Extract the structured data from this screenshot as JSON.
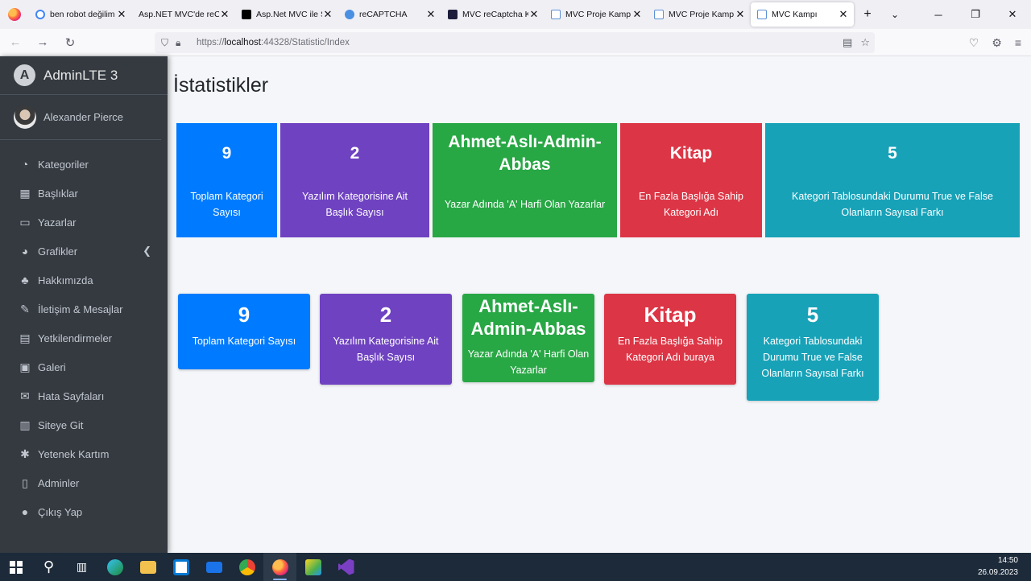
{
  "browser": {
    "tabs": [
      {
        "label": "ben robot değilim",
        "color": "#4285f4"
      },
      {
        "label": "Asp.NET MVC'de reCAPTCHA",
        "color": ""
      },
      {
        "label": "Asp.Net MVC ile S",
        "color": "#000000"
      },
      {
        "label": "reCAPTCHA",
        "color": "#4a90e2"
      },
      {
        "label": "MVC reCaptcha Ku",
        "color": "#1e1e3c"
      },
      {
        "label": "MVC Proje Kampı",
        "color": "#5b8fd6"
      },
      {
        "label": "MVC Proje Kampı",
        "color": "#5b8fd6"
      },
      {
        "label": "MVC Kampı",
        "color": "#5b8fd6"
      }
    ],
    "url_prefix": "https://",
    "url_host": "localhost",
    "url_rest": ":44328/Statistic/Index"
  },
  "sidebar": {
    "brand": "AdminLTE 3",
    "user": "Alexander Pierce",
    "items": [
      {
        "label": "Kategoriler",
        "icon": "dashboard-icon",
        "glyph": "◔"
      },
      {
        "label": "Başlıklar",
        "icon": "grid-icon",
        "glyph": "▦"
      },
      {
        "label": "Yazarlar",
        "icon": "file-icon",
        "glyph": "▭"
      },
      {
        "label": "Grafikler",
        "icon": "pie-chart-icon",
        "glyph": "◕"
      },
      {
        "label": "Hakkımızda",
        "icon": "tree-icon",
        "glyph": "♣"
      },
      {
        "label": "İletişim & Mesajlar",
        "icon": "edit-icon",
        "glyph": "✎"
      },
      {
        "label": "Yetkilendirmeler",
        "icon": "calendar-icon",
        "glyph": "▤"
      },
      {
        "label": "Galeri",
        "icon": "image-icon",
        "glyph": "▣"
      },
      {
        "label": "Hata Sayfaları",
        "icon": "envelope-icon",
        "glyph": "✉"
      },
      {
        "label": "Siteye Git",
        "icon": "calendar-icon",
        "glyph": "▥"
      },
      {
        "label": "Yetenek Kartım",
        "icon": "asterisk-icon",
        "glyph": "✱"
      },
      {
        "label": "Adminler",
        "icon": "id-icon",
        "glyph": "▯"
      },
      {
        "label": "Çıkış Yap",
        "icon": "apple-icon",
        "glyph": "●"
      }
    ]
  },
  "main": {
    "title": "İstatistikler",
    "row1": [
      {
        "value": "9",
        "label": "Toplam Kategori Sayısı",
        "color": "blue"
      },
      {
        "value": "2",
        "label": "Yazılım Kategorisine Ait Başlık Sayısı",
        "color": "purple"
      },
      {
        "value": "Ahmet-Aslı-Admin-Abbas",
        "label": "Yazar Adında 'A' Harfi Olan Yazarlar",
        "color": "green"
      },
      {
        "value": "Kitap",
        "label": "En Fazla Başlığa Sahip Kategori Adı",
        "color": "red"
      },
      {
        "value": "5",
        "label": "Kategori Tablosundaki Durumu True ve False Olanların Sayısal Farkı",
        "color": "teal"
      }
    ],
    "row2": [
      {
        "value": "9",
        "label": "Toplam Kategori Sayısı",
        "color": "blue"
      },
      {
        "value": "2",
        "label": "Yazılım Kategorisine Ait Başlık Sayısı",
        "color": "purple"
      },
      {
        "value": "Ahmet-Aslı-Admin-Abbas",
        "label": "Yazar Adında 'A' Harfi Olan Yazarlar",
        "color": "green"
      },
      {
        "value": "Kitap",
        "label": "En Fazla Başlığa Sahip Kategori Adı buraya",
        "color": "red"
      },
      {
        "value": "5",
        "label": "Kategori Tablosundaki Durumu True ve False Olanların Sayısal Farkı",
        "color": "teal"
      }
    ]
  },
  "taskbar": {
    "time": "14:50",
    "date": "26.09.2023"
  }
}
